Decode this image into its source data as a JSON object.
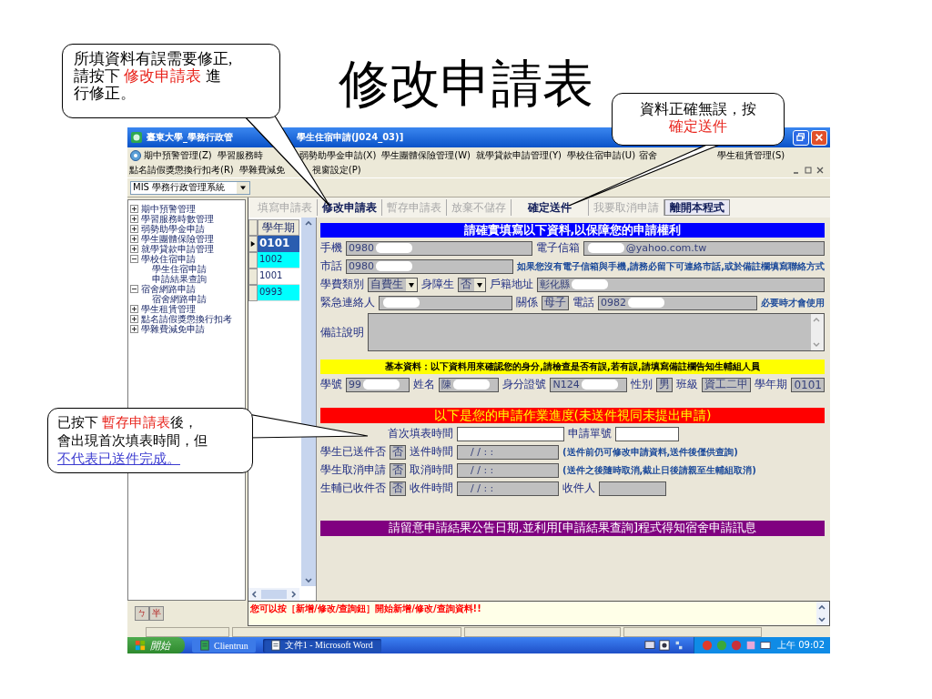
{
  "slide": {
    "title": "修改申請表"
  },
  "callouts": [
    {
      "lines": [
        [
          {
            "kind": "plain",
            "text": "所填資料有誤需要修正,"
          }
        ],
        [
          {
            "kind": "plain",
            "text": "請按下 "
          },
          {
            "kind": "red",
            "text": "修改申請表"
          },
          {
            "kind": "plain",
            "text": " 進"
          }
        ],
        [
          {
            "kind": "plain",
            "text": "行修正。"
          }
        ]
      ]
    },
    {
      "lines": [
        [
          {
            "kind": "plain",
            "text": "資料正確無誤，按"
          }
        ],
        [
          {
            "kind": "red",
            "text": "確定送件"
          }
        ]
      ]
    },
    {
      "lines": [
        [
          {
            "kind": "plain",
            "text": "已按下 "
          },
          {
            "kind": "red",
            "text": "暫存申請表"
          },
          {
            "kind": "plain",
            "text": "後，"
          }
        ],
        [
          {
            "kind": "plain",
            "text": "會出現首次填表時間，但"
          }
        ],
        [
          {
            "kind": "blue",
            "text": "不代表已送件完成。"
          }
        ]
      ]
    }
  ],
  "window": {
    "title_parts": [
      "臺東大學_學務行政管",
      "學生住宿申請(J024_03)]"
    ],
    "menus": [
      [
        "期中預警管理(Z)",
        "學習服務時",
        "弱勢助學金申請(X)",
        "學生團體保險管理(W)",
        "就學貸款申請管理(Y)",
        "學校住宿申請(U)",
        "宿舍",
        "學生租賃管理(S)"
      ],
      [
        "點名請假獎懲換行扣考(R)",
        "學雜費減免",
        "視窗設定(P)"
      ]
    ],
    "system_combo": "MIS 學務行政管理系統",
    "tree": [
      {
        "label": "期中預警管理",
        "expanded": false
      },
      {
        "label": "學習服務時數管理",
        "expanded": false
      },
      {
        "label": "弱勢助學金申請",
        "expanded": false
      },
      {
        "label": "學生團體保險管理",
        "expanded": false
      },
      {
        "label": "就學貸款申請管理",
        "expanded": false
      },
      {
        "label": "學校住宿申請",
        "expanded": true,
        "children": [
          {
            "label": "學生住宿申請"
          },
          {
            "label": "申請結果查詢"
          }
        ]
      },
      {
        "label": "宿舍網路申請",
        "expanded": true,
        "children": [
          {
            "label": "宿舍網路申請"
          }
        ]
      },
      {
        "label": "學生租賃管理",
        "expanded": false
      },
      {
        "label": "點名請假獎懲換行扣考",
        "expanded": false
      },
      {
        "label": "學雜費減免申請",
        "expanded": false
      }
    ],
    "ime_keys": [
      "ㄅ",
      "半"
    ],
    "buttons": [
      {
        "label": "填寫申請表",
        "disabled": true
      },
      {
        "label": "修改申請表",
        "disabled": false
      },
      {
        "label": "暫存申請表",
        "disabled": true
      },
      {
        "label": "放棄不儲存",
        "disabled": true
      },
      {
        "label": "確定送件",
        "disabled": false
      },
      {
        "label": "我要取消申請",
        "disabled": true
      },
      {
        "label": "離開本程式",
        "disabled": false
      }
    ],
    "grid": {
      "header": "學年期",
      "rows": [
        {
          "value": "0101",
          "selected": true
        },
        {
          "value": "1002",
          "selected": false
        },
        {
          "value": "1001",
          "selected": false
        },
        {
          "value": "0993",
          "selected": false
        }
      ]
    },
    "form": [
      {
        "kind": "banner",
        "color": "#0000ff",
        "text": "請確實填寫以下資料,以保障您的申請權利"
      },
      {
        "kind": "row",
        "indent": false,
        "items": [
          {
            "kind": "label",
            "text": "手機"
          },
          {
            "kind": "field",
            "value": "0980",
            "masked": true
          },
          {
            "kind": "label",
            "text": "電子信箱"
          },
          {
            "kind": "field",
            "value": "@yahoo.com.tw",
            "masked_before": true
          }
        ]
      },
      {
        "kind": "row",
        "indent": false,
        "items": [
          {
            "kind": "label",
            "text": "市話"
          },
          {
            "kind": "field",
            "value": "0980",
            "masked": true
          },
          {
            "kind": "note",
            "text": "如果您沒有電子信箱與手機,請務必留下可連絡市話,或於備註欄填寫聯絡方式"
          }
        ]
      },
      {
        "kind": "row",
        "indent": false,
        "items": [
          {
            "kind": "label",
            "text": "學費類別"
          },
          {
            "kind": "select",
            "value": "自費生"
          },
          {
            "kind": "label",
            "text": "身障生"
          },
          {
            "kind": "select",
            "value": "否"
          },
          {
            "kind": "label",
            "text": "戶籍地址"
          },
          {
            "kind": "field",
            "value": "彰化縣",
            "masked": true
          }
        ]
      },
      {
        "kind": "row",
        "indent": false,
        "items": [
          {
            "kind": "label",
            "text": "緊急連絡人"
          },
          {
            "kind": "field",
            "masked_before": true
          },
          {
            "kind": "label",
            "text": "關係"
          },
          {
            "kind": "flag",
            "value": "母子"
          },
          {
            "kind": "label",
            "text": "電話"
          },
          {
            "kind": "field",
            "value": "0982",
            "masked": true
          },
          {
            "kind": "note",
            "text": "必要時才會使用"
          }
        ]
      },
      {
        "kind": "row",
        "indent": false,
        "items": [
          {
            "kind": "label",
            "text": "備註說明"
          },
          {
            "kind": "memo"
          }
        ]
      },
      {
        "kind": "banner",
        "color": "#ffff00",
        "text": "基本資料：以下資料用來確認您的身分,請檢查是否有誤,若有誤,請填寫備註欄告知生輔組人員"
      },
      {
        "kind": "row",
        "indent": false,
        "items": [
          {
            "kind": "label",
            "text": "學號"
          },
          {
            "kind": "field",
            "value": "99",
            "masked": true
          },
          {
            "kind": "label",
            "text": "姓名"
          },
          {
            "kind": "field",
            "value": "陳",
            "masked": true
          },
          {
            "kind": "label",
            "text": "身分證號"
          },
          {
            "kind": "field",
            "value": "N124",
            "masked": true
          },
          {
            "kind": "label",
            "text": "性別"
          },
          {
            "kind": "flag",
            "value": "男"
          },
          {
            "kind": "label",
            "text": "班級"
          },
          {
            "kind": "flag",
            "value": "資工二甲"
          },
          {
            "kind": "label",
            "text": "學年期"
          },
          {
            "kind": "flag",
            "value": "0101"
          }
        ]
      },
      {
        "kind": "banner",
        "color": "#ff0000",
        "text": "以下是您的申請作業進度(未送件視同未提出申請)"
      },
      {
        "kind": "row",
        "indent": true,
        "items": [
          {
            "kind": "label",
            "text": "首次填表時間"
          },
          {
            "kind": "entry"
          },
          {
            "kind": "label",
            "text": "申請單號"
          },
          {
            "kind": "entry"
          }
        ]
      },
      {
        "kind": "row",
        "indent": false,
        "items": [
          {
            "kind": "label",
            "text": "學生已送件否"
          },
          {
            "kind": "flag",
            "value": "否"
          },
          {
            "kind": "label",
            "text": "送件時間"
          },
          {
            "kind": "time",
            "value": "/ /   : :"
          },
          {
            "kind": "note",
            "text": "(送件前仍可修改申請資料,送件後僅供查詢)"
          }
        ]
      },
      {
        "kind": "row",
        "indent": false,
        "items": [
          {
            "kind": "label",
            "text": "學生取消申請"
          },
          {
            "kind": "flag",
            "value": "否"
          },
          {
            "kind": "label",
            "text": "取消時間"
          },
          {
            "kind": "time",
            "value": "/ /   : :"
          },
          {
            "kind": "note",
            "text": "(送件之後隨時取消,截止日後請親至生輔組取消)"
          }
        ]
      },
      {
        "kind": "row",
        "indent": false,
        "items": [
          {
            "kind": "label",
            "text": "生輔已收件否"
          },
          {
            "kind": "flag",
            "value": "否"
          },
          {
            "kind": "label",
            "text": "收件時間"
          },
          {
            "kind": "time",
            "value": "/ /   : :"
          },
          {
            "kind": "label",
            "text": "收件人"
          },
          {
            "kind": "blank"
          }
        ]
      },
      {
        "kind": "banner",
        "color": "#800080",
        "text": "請留意申請結果公告日期,並利用[申請結果查詢]程式得知宿舍申請訊息"
      }
    ],
    "message": "您可以按［新增/修改/查詢鈕］開始新增/修改/查詢資料!!",
    "taskbar": {
      "start": "開始",
      "tasks": [
        {
          "label": "Clientrun",
          "active": false
        },
        {
          "label": "文件1 - Microsoft Word",
          "active": true
        }
      ],
      "clock": "上午 09:02"
    }
  }
}
